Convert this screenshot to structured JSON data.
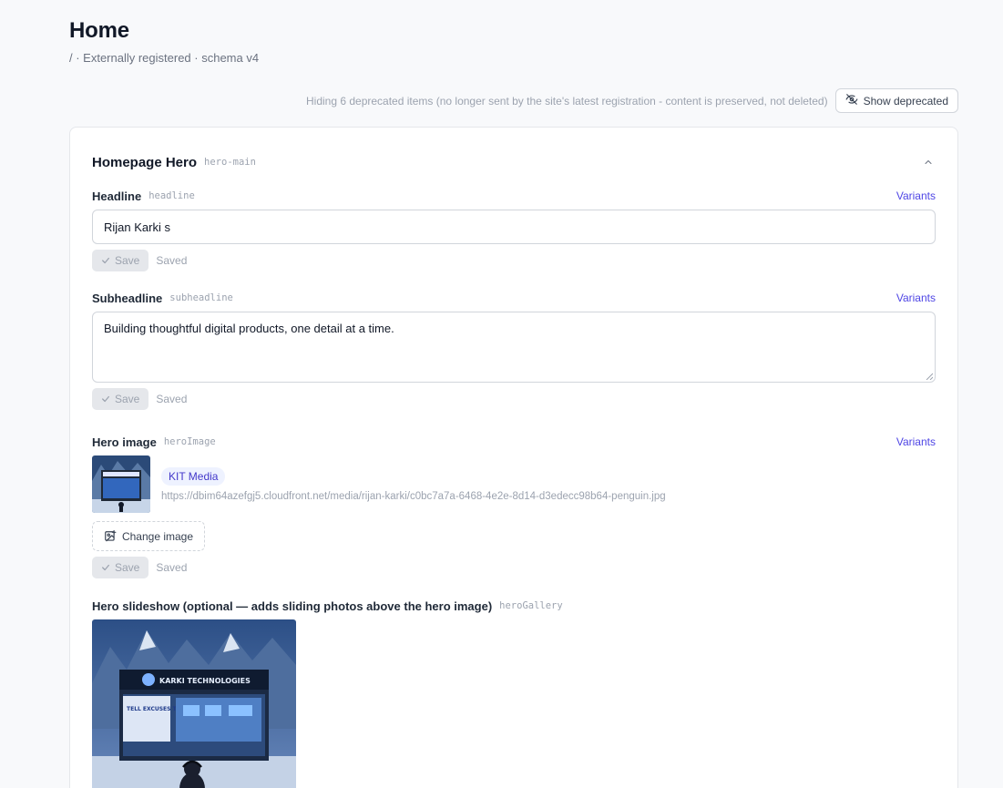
{
  "page": {
    "title": "Home",
    "meta": "/ · Externally registered · schema v4"
  },
  "deprecated": {
    "note": "Hiding 6 deprecated items (no longer sent by the site's latest registration - content is preserved, not deleted)",
    "button_label": "Show deprecated"
  },
  "section": {
    "title": "Homepage Hero",
    "key": "hero-main"
  },
  "fields": {
    "headline": {
      "label": "Headline",
      "key": "headline",
      "variants_label": "Variants",
      "value": "Rijan Karki  s",
      "save_label": "Save",
      "status": "Saved"
    },
    "subheadline": {
      "label": "Subheadline",
      "key": "subheadline",
      "variants_label": "Variants",
      "value": "Building thoughtful digital products, one detail at a time.",
      "save_label": "Save",
      "status": "Saved"
    },
    "hero_image": {
      "label": "Hero image",
      "key": "heroImage",
      "variants_label": "Variants",
      "source_badge": "KIT Media",
      "url": "https://dbim64azefgj5.cloudfront.net/media/rijan-karki/c0bc7a7a-6468-4e2e-8d14-d3edecc98b64-penguin.jpg",
      "change_label": "Change image",
      "save_label": "Save",
      "status": "Saved"
    },
    "hero_gallery": {
      "label": "Hero slideshow (optional — adds sliding photos above the hero image)",
      "key": "heroGallery",
      "image": {
        "sign_text": "KARKI TECHNOLOGIES",
        "poster_text": "TELL EXCUSES TO FREEZE"
      }
    }
  },
  "icons": {
    "show_deprecated": "eye-off-icon",
    "collapse": "chevron-up-icon",
    "save": "check-icon",
    "change_image": "image-plus-icon"
  },
  "colors": {
    "accent": "#4f46e5",
    "badge_bg": "#eef2ff",
    "muted": "#9ca3af"
  }
}
